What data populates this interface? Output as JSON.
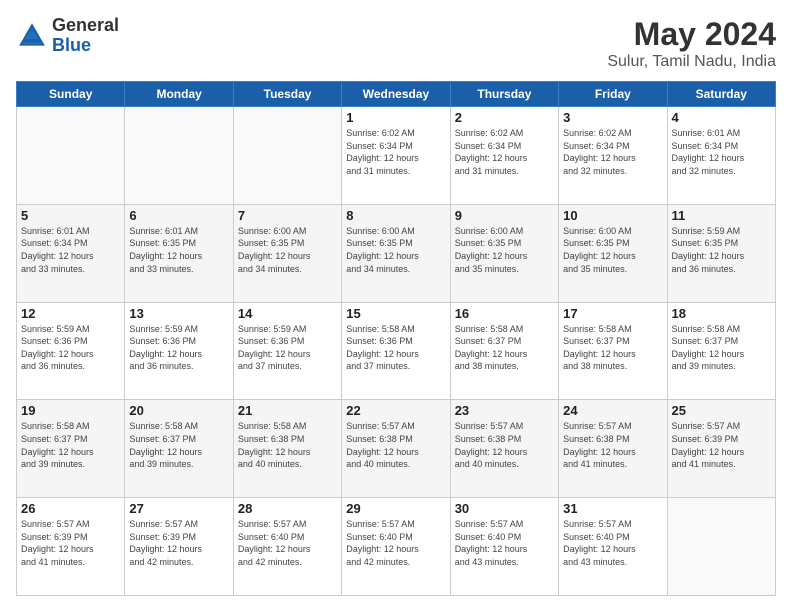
{
  "logo": {
    "general": "General",
    "blue": "Blue"
  },
  "header": {
    "month_year": "May 2024",
    "location": "Sulur, Tamil Nadu, India"
  },
  "days_of_week": [
    "Sunday",
    "Monday",
    "Tuesday",
    "Wednesday",
    "Thursday",
    "Friday",
    "Saturday"
  ],
  "weeks": [
    {
      "shade": false,
      "days": [
        {
          "num": "",
          "info": ""
        },
        {
          "num": "",
          "info": ""
        },
        {
          "num": "",
          "info": ""
        },
        {
          "num": "1",
          "info": "Sunrise: 6:02 AM\nSunset: 6:34 PM\nDaylight: 12 hours\nand 31 minutes."
        },
        {
          "num": "2",
          "info": "Sunrise: 6:02 AM\nSunset: 6:34 PM\nDaylight: 12 hours\nand 31 minutes."
        },
        {
          "num": "3",
          "info": "Sunrise: 6:02 AM\nSunset: 6:34 PM\nDaylight: 12 hours\nand 32 minutes."
        },
        {
          "num": "4",
          "info": "Sunrise: 6:01 AM\nSunset: 6:34 PM\nDaylight: 12 hours\nand 32 minutes."
        }
      ]
    },
    {
      "shade": true,
      "days": [
        {
          "num": "5",
          "info": "Sunrise: 6:01 AM\nSunset: 6:34 PM\nDaylight: 12 hours\nand 33 minutes."
        },
        {
          "num": "6",
          "info": "Sunrise: 6:01 AM\nSunset: 6:35 PM\nDaylight: 12 hours\nand 33 minutes."
        },
        {
          "num": "7",
          "info": "Sunrise: 6:00 AM\nSunset: 6:35 PM\nDaylight: 12 hours\nand 34 minutes."
        },
        {
          "num": "8",
          "info": "Sunrise: 6:00 AM\nSunset: 6:35 PM\nDaylight: 12 hours\nand 34 minutes."
        },
        {
          "num": "9",
          "info": "Sunrise: 6:00 AM\nSunset: 6:35 PM\nDaylight: 12 hours\nand 35 minutes."
        },
        {
          "num": "10",
          "info": "Sunrise: 6:00 AM\nSunset: 6:35 PM\nDaylight: 12 hours\nand 35 minutes."
        },
        {
          "num": "11",
          "info": "Sunrise: 5:59 AM\nSunset: 6:35 PM\nDaylight: 12 hours\nand 36 minutes."
        }
      ]
    },
    {
      "shade": false,
      "days": [
        {
          "num": "12",
          "info": "Sunrise: 5:59 AM\nSunset: 6:36 PM\nDaylight: 12 hours\nand 36 minutes."
        },
        {
          "num": "13",
          "info": "Sunrise: 5:59 AM\nSunset: 6:36 PM\nDaylight: 12 hours\nand 36 minutes."
        },
        {
          "num": "14",
          "info": "Sunrise: 5:59 AM\nSunset: 6:36 PM\nDaylight: 12 hours\nand 37 minutes."
        },
        {
          "num": "15",
          "info": "Sunrise: 5:58 AM\nSunset: 6:36 PM\nDaylight: 12 hours\nand 37 minutes."
        },
        {
          "num": "16",
          "info": "Sunrise: 5:58 AM\nSunset: 6:37 PM\nDaylight: 12 hours\nand 38 minutes."
        },
        {
          "num": "17",
          "info": "Sunrise: 5:58 AM\nSunset: 6:37 PM\nDaylight: 12 hours\nand 38 minutes."
        },
        {
          "num": "18",
          "info": "Sunrise: 5:58 AM\nSunset: 6:37 PM\nDaylight: 12 hours\nand 39 minutes."
        }
      ]
    },
    {
      "shade": true,
      "days": [
        {
          "num": "19",
          "info": "Sunrise: 5:58 AM\nSunset: 6:37 PM\nDaylight: 12 hours\nand 39 minutes."
        },
        {
          "num": "20",
          "info": "Sunrise: 5:58 AM\nSunset: 6:37 PM\nDaylight: 12 hours\nand 39 minutes."
        },
        {
          "num": "21",
          "info": "Sunrise: 5:58 AM\nSunset: 6:38 PM\nDaylight: 12 hours\nand 40 minutes."
        },
        {
          "num": "22",
          "info": "Sunrise: 5:57 AM\nSunset: 6:38 PM\nDaylight: 12 hours\nand 40 minutes."
        },
        {
          "num": "23",
          "info": "Sunrise: 5:57 AM\nSunset: 6:38 PM\nDaylight: 12 hours\nand 40 minutes."
        },
        {
          "num": "24",
          "info": "Sunrise: 5:57 AM\nSunset: 6:38 PM\nDaylight: 12 hours\nand 41 minutes."
        },
        {
          "num": "25",
          "info": "Sunrise: 5:57 AM\nSunset: 6:39 PM\nDaylight: 12 hours\nand 41 minutes."
        }
      ]
    },
    {
      "shade": false,
      "days": [
        {
          "num": "26",
          "info": "Sunrise: 5:57 AM\nSunset: 6:39 PM\nDaylight: 12 hours\nand 41 minutes."
        },
        {
          "num": "27",
          "info": "Sunrise: 5:57 AM\nSunset: 6:39 PM\nDaylight: 12 hours\nand 42 minutes."
        },
        {
          "num": "28",
          "info": "Sunrise: 5:57 AM\nSunset: 6:40 PM\nDaylight: 12 hours\nand 42 minutes."
        },
        {
          "num": "29",
          "info": "Sunrise: 5:57 AM\nSunset: 6:40 PM\nDaylight: 12 hours\nand 42 minutes."
        },
        {
          "num": "30",
          "info": "Sunrise: 5:57 AM\nSunset: 6:40 PM\nDaylight: 12 hours\nand 43 minutes."
        },
        {
          "num": "31",
          "info": "Sunrise: 5:57 AM\nSunset: 6:40 PM\nDaylight: 12 hours\nand 43 minutes."
        },
        {
          "num": "",
          "info": ""
        }
      ]
    }
  ]
}
